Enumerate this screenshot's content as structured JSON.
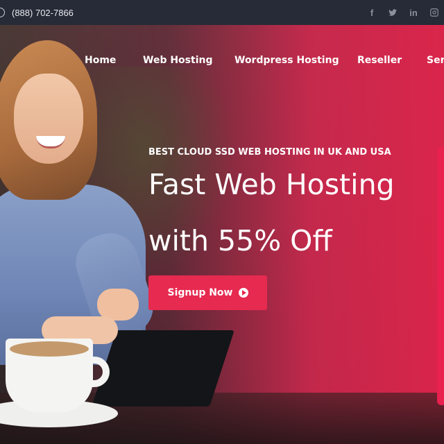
{
  "topbar": {
    "phone": "(888) 702-7866",
    "icons": [
      "phone-icon",
      "facebook-icon",
      "twitter-icon",
      "linkedin-icon",
      "instagram-icon"
    ]
  },
  "nav": {
    "items": [
      {
        "label": "Home"
      },
      {
        "label": "Web Hosting"
      },
      {
        "label": "Wordpress Hosting"
      },
      {
        "label": "Reseller"
      },
      {
        "label": "Ser"
      }
    ]
  },
  "hero": {
    "eyebrow": "BEST CLOUD SSD WEB HOSTING IN UK AND USA",
    "headline_line1": "Fast Web Hosting",
    "headline_line2": "with 55% Off",
    "cta_label": "Signup Now",
    "cta_icon": "play-circle-icon"
  },
  "colors": {
    "topbar_bg": "#262b37",
    "accent": "#e62a50",
    "gradient_end": "#e2244c"
  }
}
